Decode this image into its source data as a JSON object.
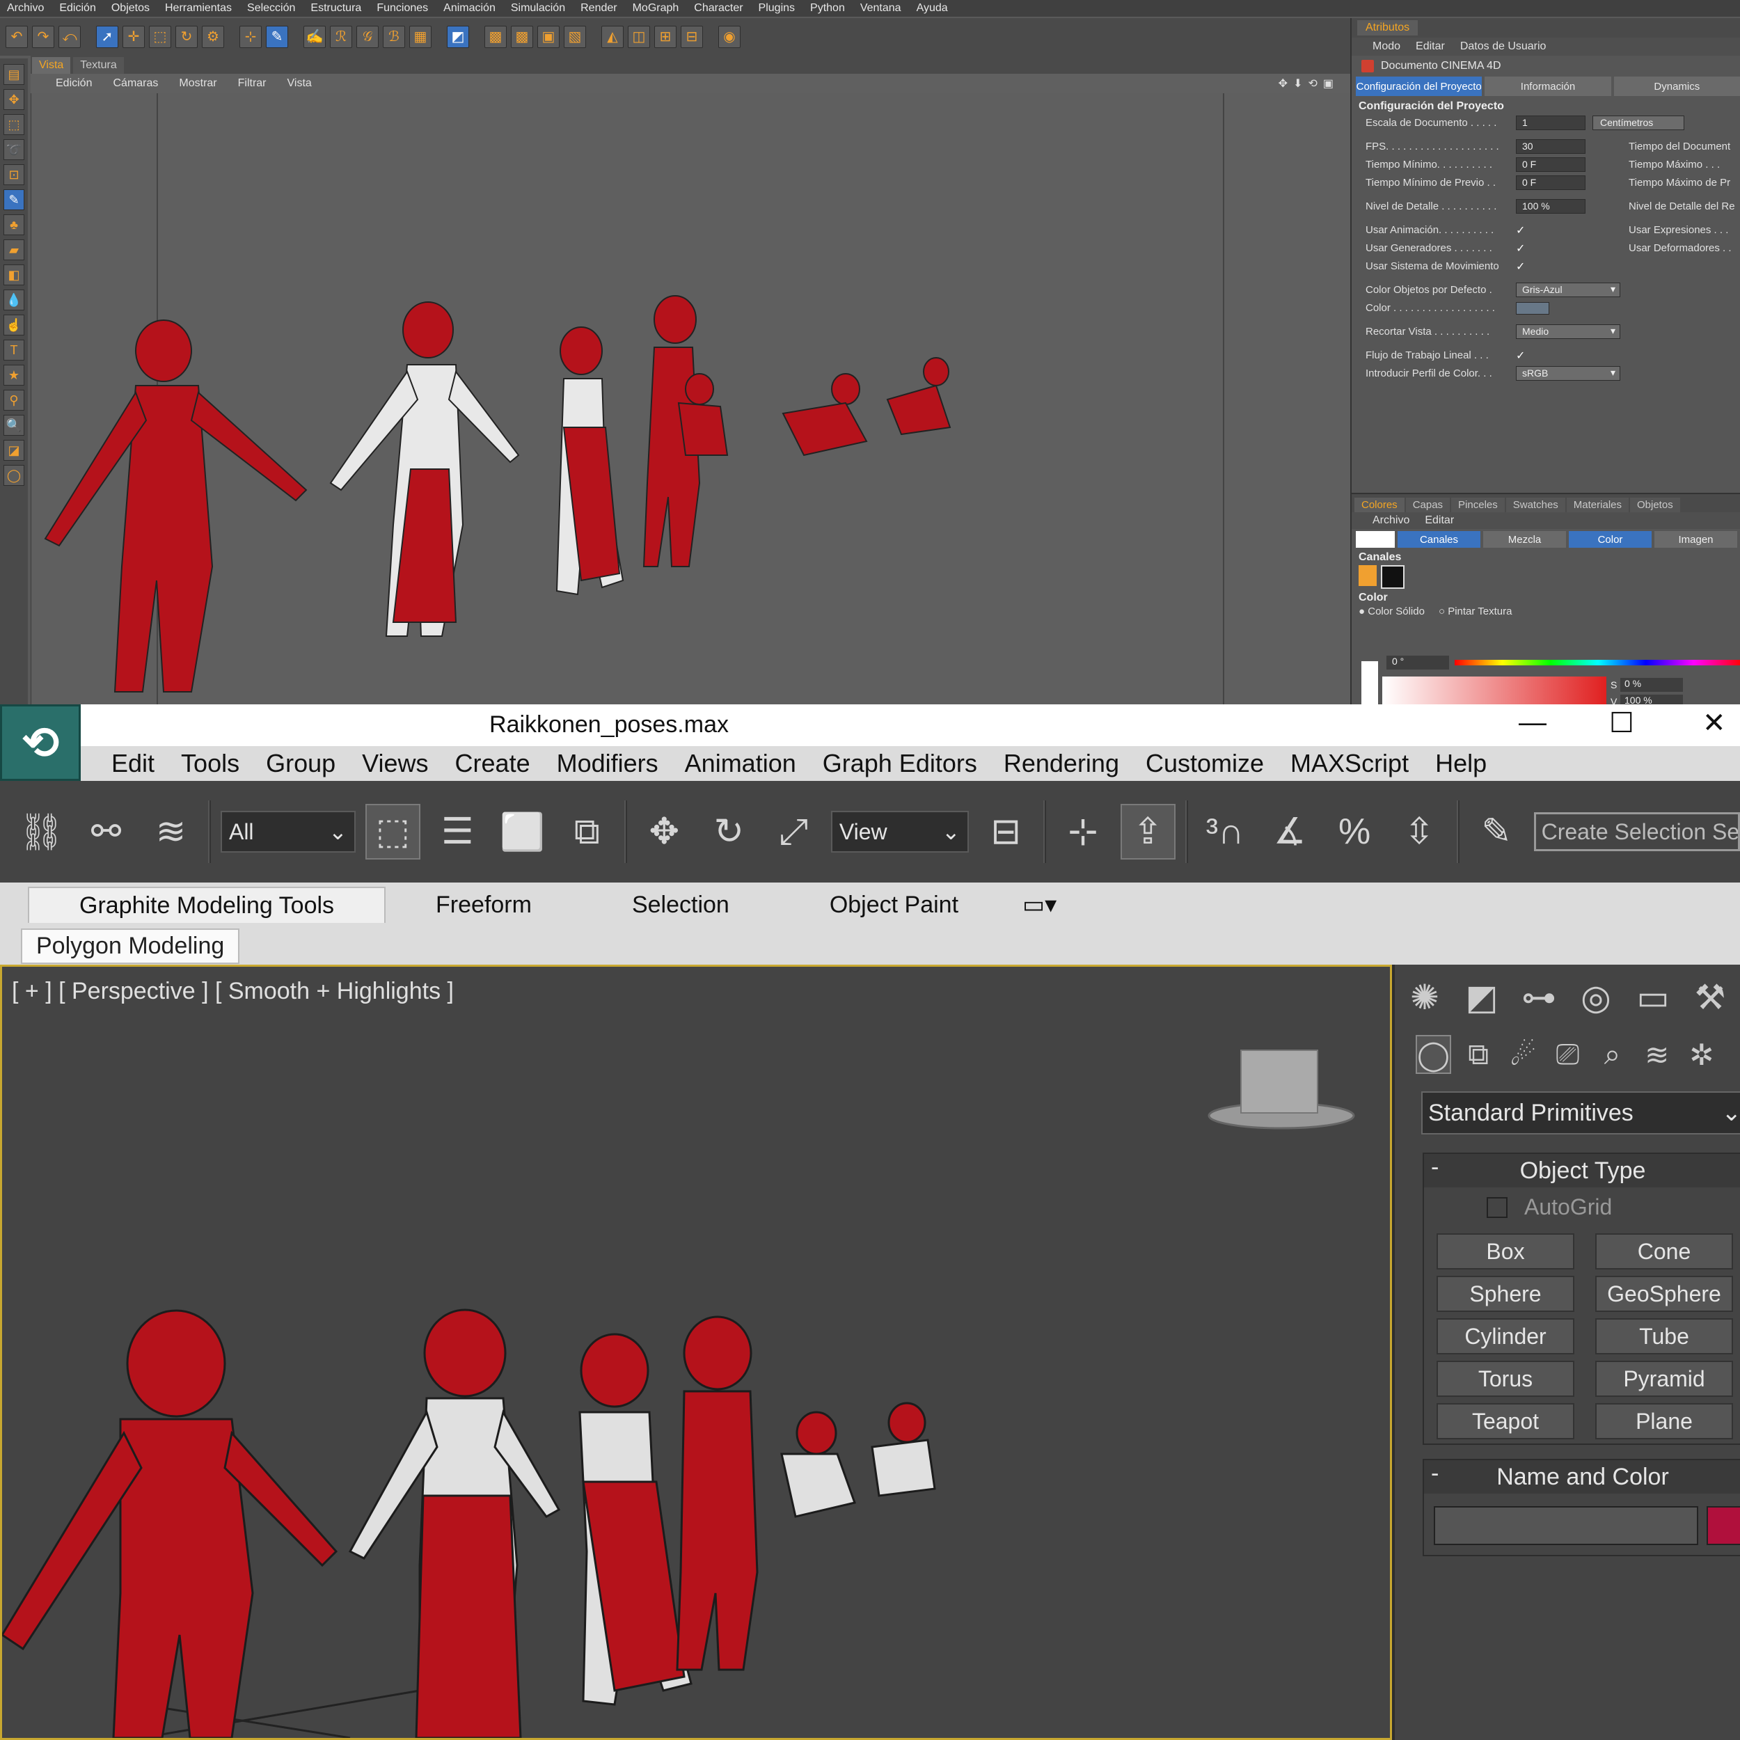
{
  "c4d": {
    "menu": [
      "Archivo",
      "Edición",
      "Objetos",
      "Herramientas",
      "Selección",
      "Estructura",
      "Funciones",
      "Animación",
      "Simulación",
      "Render",
      "MoGraph",
      "Character",
      "Plugins",
      "Python",
      "Ventana",
      "Ayuda"
    ],
    "view_tabs": [
      "Vista",
      "Textura"
    ],
    "view_menu": [
      "Edición",
      "Cámaras",
      "Mostrar",
      "Filtrar",
      "Vista"
    ],
    "attributes": {
      "panel_title": "Atributos",
      "menu": [
        "Modo",
        "Editar",
        "Datos de Usuario"
      ],
      "document_title": "Documento CINEMA 4D",
      "tabs": [
        "Configuración del Proyecto",
        "Información",
        "Dynamics"
      ],
      "section_title": "Configuración del Proyecto",
      "escala_label": "Escala de Documento . . . . .",
      "escala_value": "1",
      "escala_unit": "Centímetros",
      "fps_label": "FPS. . . . . . . . . . . . . . . . . . . .",
      "fps_value": "30",
      "tiempo_doc_label": "Tiempo del Document",
      "tiempo_min_label": "Tiempo Mínimo. . . . . . . . . .",
      "tiempo_min_value": "0 F",
      "tiempo_max_label": "Tiempo Máximo . . .",
      "tiempo_min_prev_label": "Tiempo Mínimo de Previo . .",
      "tiempo_min_prev_value": "0 F",
      "tiempo_max_prev_label": "Tiempo Máximo de Pr",
      "nivel_label": "Nivel de Detalle . . . . . . . . . .",
      "nivel_value": "100 %",
      "nivel_render_label": "Nivel de Detalle del Re",
      "usar_anim_label": "Usar Animación. . . . . . . . . .",
      "usar_expr_label": "Usar Expresiones . . .",
      "usar_gen_label": "Usar Generadores . . . . . . .",
      "usar_def_label": "Usar Deformadores . .",
      "usar_mov_label": "Usar Sistema de Movimiento",
      "color_obj_label": "Color Objetos por Defecto .",
      "color_obj_value": "Gris-Azul",
      "color_label": "Color . . . . . . . . . . . . . . . . . .",
      "recortar_label": "Recortar Vista . . . . . . . . . .",
      "recortar_value": "Medio",
      "flujo_label": "Flujo de Trabajo Lineal . . .",
      "perfil_label": "Introducir Perfil de Color. . .",
      "perfil_value": "sRGB",
      "check": "✓"
    },
    "colors": {
      "tabs": [
        "Colores",
        "Capas",
        "Pinceles",
        "Swatches",
        "Materiales",
        "Objetos"
      ],
      "menu": [
        "Archivo",
        "Editar"
      ],
      "buttons": [
        "Canales",
        "Mezcla",
        "Color",
        "Imagen"
      ],
      "canales_title": "Canales",
      "color_title": "Color",
      "color_solido": "Color Sólido",
      "pintar_textura": "Pintar Textura",
      "hue_value": "0 °",
      "s_label": "S",
      "s_value": "0 %",
      "v_label": "V",
      "v_value": "100 %"
    }
  },
  "max": {
    "title": "Raikkonen_poses.max",
    "window_buttons": [
      "—",
      "☐",
      "✕"
    ],
    "menu": [
      "Edit",
      "Tools",
      "Group",
      "Views",
      "Create",
      "Modifiers",
      "Animation",
      "Graph Editors",
      "Rendering",
      "Customize",
      "MAXScript",
      "Help"
    ],
    "selection_filter": "All",
    "ref_coord": "View",
    "create_selection_set": "Create Selection Se",
    "ribbon_tabs": [
      "Graphite Modeling Tools",
      "Freeform",
      "Selection",
      "Object Paint"
    ],
    "subribbon": "Polygon Modeling",
    "viewport_label": "[ + ] [ Perspective ] [ Smooth + Highlights ]",
    "primitives_dropdown": "Standard Primitives",
    "object_type_title": "Object Type",
    "autogrid": "AutoGrid",
    "primitives": [
      "Box",
      "Cone",
      "Sphere",
      "GeoSphere",
      "Cylinder",
      "Tube",
      "Torus",
      "Pyramid",
      "Teapot",
      "Plane"
    ],
    "name_color_title": "Name and Color",
    "object_color": "#b0103c",
    "rollout_minus": "-"
  }
}
